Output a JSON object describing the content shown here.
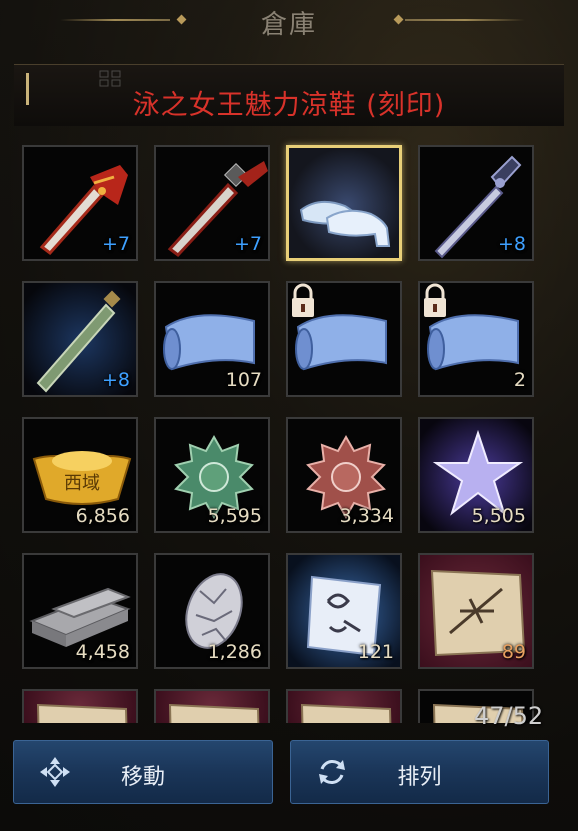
{
  "window": {
    "title": "倉庫"
  },
  "tooltip": {
    "item_name": "泳之女王魅力涼鞋 (刻印)"
  },
  "slots": [
    {
      "icon": "red-sword-icon",
      "count": "+7",
      "enhance": true
    },
    {
      "icon": "red-dagger-icon",
      "count": "+7",
      "enhance": true
    },
    {
      "icon": "glass-slippers-icon",
      "count": "",
      "enhance": false,
      "selected": true
    },
    {
      "icon": "dark-blade-icon",
      "count": "+8",
      "enhance": true
    },
    {
      "icon": "green-sword-icon",
      "count": "+8",
      "enhance": true
    },
    {
      "icon": "blue-scroll-icon",
      "count": "107",
      "enhance": false
    },
    {
      "icon": "locked-scroll-icon",
      "count": "",
      "enhance": false,
      "locked": true
    },
    {
      "icon": "locked-scroll-icon",
      "count": "2",
      "enhance": false,
      "locked": true
    },
    {
      "icon": "gold-ingot-icon",
      "count": "6,856",
      "enhance": false
    },
    {
      "icon": "green-medallion-icon",
      "count": "5,595",
      "enhance": false
    },
    {
      "icon": "red-medallion-icon",
      "count": "3,334",
      "enhance": false
    },
    {
      "icon": "purple-star-icon",
      "count": "5,505",
      "enhance": false
    },
    {
      "icon": "iron-bars-icon",
      "count": "4,458",
      "enhance": false
    },
    {
      "icon": "crystal-ore-icon",
      "count": "1,286",
      "enhance": false
    },
    {
      "icon": "blue-rune-scroll-icon",
      "count": "121",
      "enhance": false
    },
    {
      "icon": "parchment-icon",
      "count": "89",
      "enhance": false,
      "red_bg": true
    },
    {
      "icon": "parchment-icon",
      "count": "",
      "enhance": false,
      "red_bg": true
    },
    {
      "icon": "parchment-icon",
      "count": "",
      "enhance": false,
      "red_bg": true
    },
    {
      "icon": "parchment-icon",
      "count": "",
      "enhance": false,
      "red_bg": true
    },
    {
      "icon": "parchment-icon",
      "count": "",
      "enhance": false
    }
  ],
  "ingot_label": "西域",
  "capacity": "47/52",
  "buttons": {
    "move": {
      "label": "移動",
      "icon": "move-arrows-icon"
    },
    "sort": {
      "label": "排列",
      "icon": "refresh-icon"
    }
  },
  "colors": {
    "item_name": "#d8322a",
    "enhance": "#3ea0ff",
    "selected_border": "#e8cf78",
    "button": "#1a3558"
  }
}
